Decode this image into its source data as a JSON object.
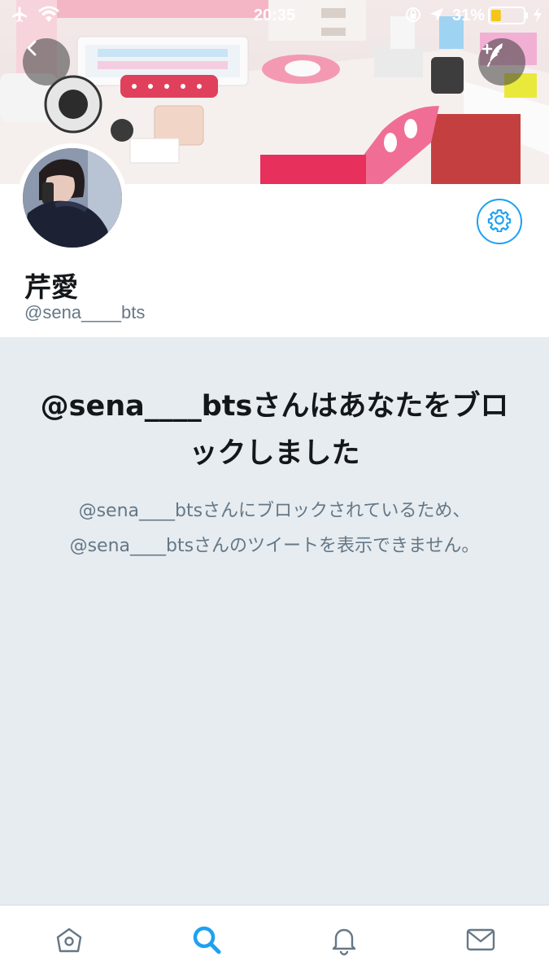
{
  "status_bar": {
    "time": "20:35",
    "battery_percent": "31%",
    "battery_level": 0.31,
    "icons": [
      "airplane-icon",
      "wifi-icon",
      "rotation-lock-icon",
      "location-icon",
      "battery-icon",
      "charging-icon"
    ]
  },
  "header": {
    "back_icon": "chevron-left-icon",
    "compose_icon": "add-compose-icon"
  },
  "profile": {
    "display_name": "芹愛",
    "handle": "@sena____bts",
    "settings_icon": "gear-icon"
  },
  "blocked_notice": {
    "title": "@sena____btsさんはあなたをブロックしました",
    "message": "@sena____btsさんにブロックされているため、@sena____btsさんのツイートを表示できません。"
  },
  "tab_bar": {
    "items": [
      {
        "name": "home",
        "icon": "home-icon",
        "active": false
      },
      {
        "name": "search",
        "icon": "search-icon",
        "active": true
      },
      {
        "name": "notifications",
        "icon": "bell-icon",
        "active": false
      },
      {
        "name": "messages",
        "icon": "mail-icon",
        "active": false
      }
    ]
  },
  "colors": {
    "accent": "#1da1f2",
    "background": "#e6ecf0",
    "text_primary": "#14171a",
    "text_secondary": "#657786",
    "tab_inactive": "#657786"
  }
}
